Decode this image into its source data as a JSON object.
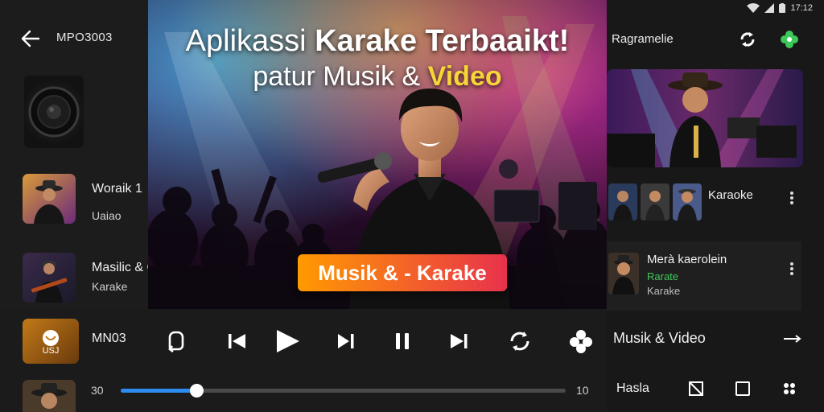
{
  "left_panel": {
    "title": "MPO3003",
    "items": [
      {
        "title": "Woraik 1",
        "subtitle": "Uaiao"
      },
      {
        "title": "Masilic & Curladkes",
        "subtitle": "Karake"
      }
    ]
  },
  "video": {
    "headline_light": "Aplikassi",
    "headline_bold": "Karake Terbaaikt!",
    "subheadline_prefix": "patur Musik & ",
    "subheadline_highlight": "Video",
    "badge": "Musik & - Karake"
  },
  "player": {
    "now_playing_title": "MN03",
    "now_playing_thumb_label": "USJ",
    "time_start": "30",
    "time_end": "10",
    "progress": 0.17
  },
  "right_panel": {
    "status_time": "17:12",
    "title": "Ragramelie",
    "karaoke_label": "Karaoke",
    "card": {
      "title": "Merà kaerolein",
      "tag": "Rarate",
      "subtitle": "Karake"
    },
    "section_label": "Musik & Video",
    "footer_label": "Hasla"
  },
  "colors": {
    "accent": "#2d8cf0",
    "highlight": "#f7d43a",
    "tag_green": "#3ec85a",
    "badge_from": "#ff9a00",
    "badge_to": "#e8324c"
  }
}
